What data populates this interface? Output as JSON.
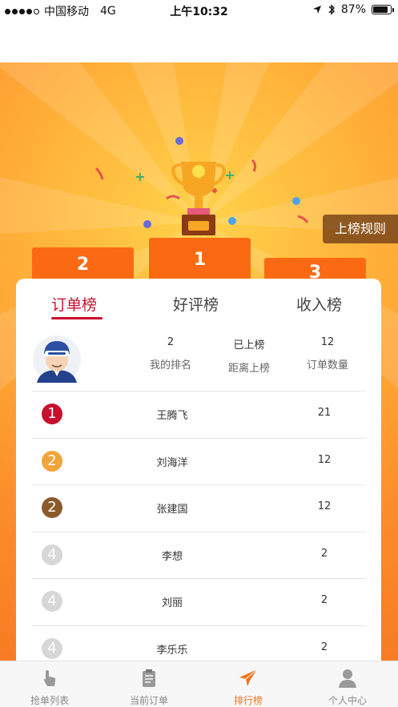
{
  "status_bar": {
    "carrier": "中国移动",
    "network": "4G",
    "time": "上午10:32",
    "battery": "87%",
    "battery_level": 0.87
  },
  "header": {
    "rules_button": "上榜规则",
    "podium": {
      "first": "1",
      "second": "2",
      "third": "3"
    }
  },
  "tabs": [
    {
      "label": "订单榜",
      "active": true
    },
    {
      "label": "好评榜",
      "active": false
    },
    {
      "label": "收入榜",
      "active": false
    }
  ],
  "summary": {
    "rank_value": "2",
    "rank_label": "我的排名",
    "distance_value": "已上榜",
    "distance_label": "距离上榜",
    "orders_value": "12",
    "orders_label": "订单数量"
  },
  "ranking": [
    {
      "rank": "1",
      "name": "王腾飞",
      "count": "21",
      "badge_color": "#c8102e"
    },
    {
      "rank": "2",
      "name": "刘海洋",
      "count": "12",
      "badge_color": "#f1a43a"
    },
    {
      "rank": "2",
      "name": "张建国",
      "count": "12",
      "badge_color": "#8b5a2b"
    },
    {
      "rank": "4",
      "name": "李想",
      "count": "2",
      "badge_color": "#d7d7d7"
    },
    {
      "rank": "4",
      "name": "刘丽",
      "count": "2",
      "badge_color": "#d7d7d7"
    },
    {
      "rank": "4",
      "name": "李乐乐",
      "count": "2",
      "badge_color": "#d7d7d7"
    }
  ],
  "tabbar": [
    {
      "label": "抢单列表",
      "icon": "hand-pointer-icon",
      "active": false
    },
    {
      "label": "当前订单",
      "icon": "clipboard-icon",
      "active": false
    },
    {
      "label": "排行榜",
      "icon": "paper-plane-icon",
      "active": true
    },
    {
      "label": "个人中心",
      "icon": "person-icon",
      "active": false
    }
  ],
  "colors": {
    "accent": "#c8102e",
    "podium": "#fb6a12",
    "active_tab": "#f0741f"
  }
}
